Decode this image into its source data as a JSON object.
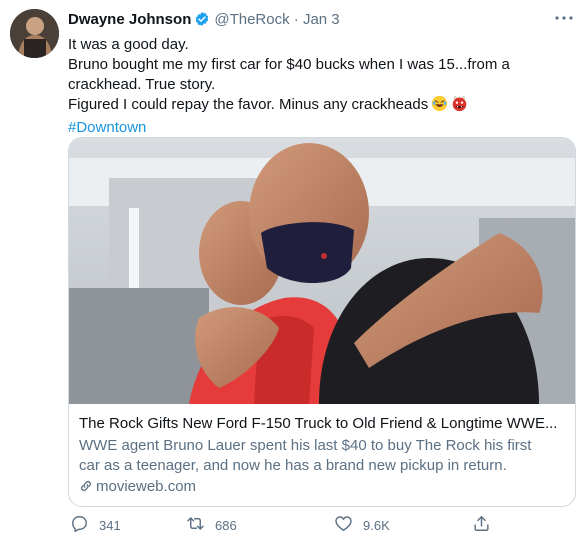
{
  "author": {
    "name": "Dwayne Johnson",
    "handle": "@TheRock",
    "separator": "·",
    "date": "Jan 3"
  },
  "tweet": {
    "lines": [
      "It was a good day.",
      "Bruno bought me my first car for $40 bucks when I was 15...from a",
      "crackhead. True story.",
      "Figured I could repay the favor. Minus any crackheads"
    ],
    "hashtag": "#Downtown"
  },
  "card": {
    "title": "The Rock Gifts New Ford F-150 Truck to Old Friend & Longtime WWE...",
    "description_lines": [
      "WWE agent Bruno Lauer spent his last $40 to buy The Rock his first",
      "car as a teenager, and now he has a brand new pickup in return."
    ],
    "domain": "movieweb.com"
  },
  "actions": {
    "replies": "341",
    "retweets": "686",
    "likes": "9.6K"
  },
  "icons": {
    "more": "more-icon",
    "reply": "reply-icon",
    "retweet": "retweet-icon",
    "like": "like-icon",
    "share": "share-icon",
    "link": "link-icon",
    "verified": "verified-badge-icon"
  },
  "colors": {
    "link": "#1b95e0",
    "muted": "#5b7083",
    "text": "#0f1419",
    "verified": "#1da1f2",
    "border": "#cfd9de"
  }
}
